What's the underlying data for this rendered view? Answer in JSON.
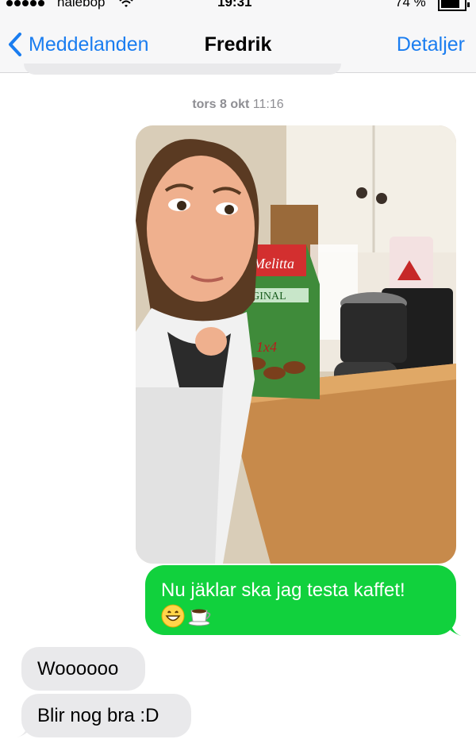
{
  "status_bar": {
    "carrier": "halebop",
    "time": "19:31",
    "battery": "74 %",
    "battery_level": 0.74,
    "signal_dots": 5,
    "icons": [
      "signal-icon",
      "wifi-icon",
      "battery-icon"
    ]
  },
  "nav": {
    "back_label": "Meddelanden",
    "title": "Fredrik",
    "details_label": "Detaljer"
  },
  "thread": {
    "timestamp_day": "tors 8 okt",
    "timestamp_time": "11:16",
    "photo": {
      "texts": {
        "brand": "Melitta",
        "box_label": "ORIGINAL",
        "box_size": "1x4"
      }
    },
    "messages": [
      {
        "direction": "outgoing",
        "text": "Nu jäklar ska jag testa kaffet!",
        "emoji": [
          "grinning-face-emoji",
          "coffee-cup-emoji"
        ]
      },
      {
        "direction": "incoming",
        "text": "Woooooo"
      },
      {
        "direction": "incoming",
        "text": "Blir nog bra :D"
      }
    ]
  },
  "colors": {
    "accent": "#1a7df0",
    "outgoing_bubble": "#11d13d",
    "incoming_bubble": "#e9e9eb",
    "nav_background": "#f7f7f8"
  }
}
